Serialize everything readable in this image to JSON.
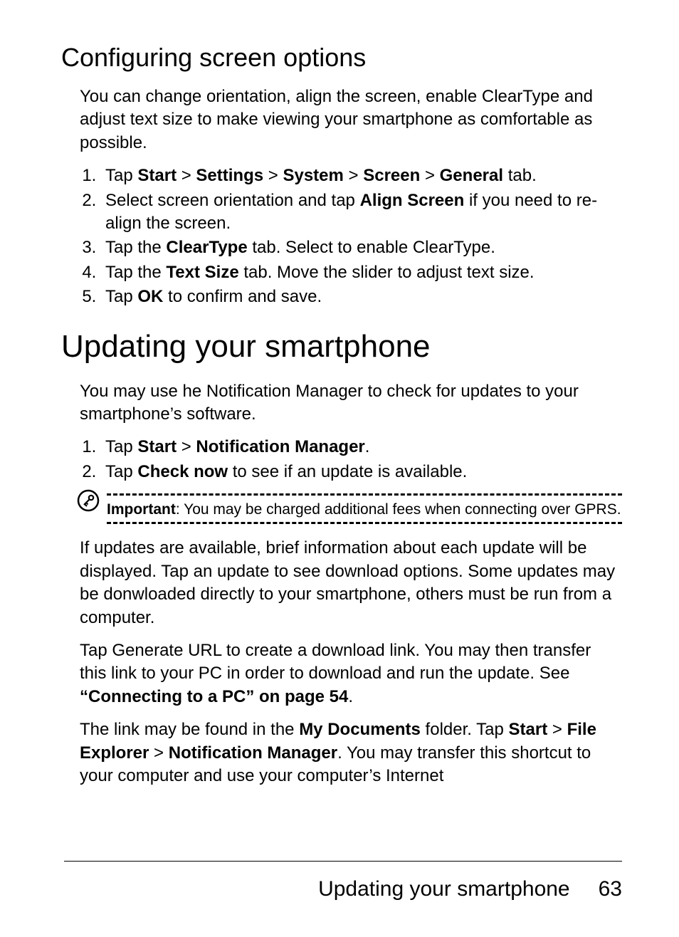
{
  "section1": {
    "heading": "Configuring screen options",
    "intro": "You can change orientation, align the screen, enable ClearType and adjust text size to make viewing your smart­phone as comfortable as possible.",
    "steps": {
      "s1_a": "Tap ",
      "s1_b": "Start",
      "s1_c": " > ",
      "s1_d": "Settings",
      "s1_e": " > ",
      "s1_f": "System",
      "s1_g": " > ",
      "s1_h": "Screen",
      "s1_i": " > ",
      "s1_j": "General",
      "s1_k": " tab.",
      "s2_a": "Select screen orientation and tap ",
      "s2_b": "Align Screen",
      "s2_c": " if you need to re-align the screen.",
      "s3_a": "Tap the ",
      "s3_b": "ClearType",
      "s3_c": " tab. Select to enable ClearType.",
      "s4_a": "Tap the ",
      "s4_b": "Text Size",
      "s4_c": " tab. Move the slider to adjust text size.",
      "s5_a": "Tap ",
      "s5_b": "OK",
      "s5_c": " to confirm and save."
    }
  },
  "section2": {
    "heading": "Updating your smartphone",
    "intro": "You may use he Notification Manager to check for updates to your smartphone’s software.",
    "steps": {
      "s1_a": "Tap ",
      "s1_b": "Start",
      "s1_c": " > ",
      "s1_d": "Notification Manager",
      "s1_e": ".",
      "s2_a": "Tap ",
      "s2_b": "Check now",
      "s2_c": " to see if an update is available."
    },
    "note": {
      "label": "Important",
      "text": ": You may be charged additional fees when connecting over GPRS."
    },
    "para1": "If updates are available, brief information about each update will be displayed. Tap an update to see download options. Some updates may be donwloaded directly to your smart­phone, others must be run from a computer.",
    "para2_a": "Tap Generate URL to create a download link. You may then transfer this link to your PC in order to download and run the update. See ",
    "para2_b": "“Connecting to a PC” on page 54",
    "para2_c": ".",
    "para3_a": "The link may be found in the ",
    "para3_b": "My Documents",
    "para3_c": " folder. Tap ",
    "para3_d": "Start",
    "para3_e": " > ",
    "para3_f": "File Explorer",
    "para3_g": " > ",
    "para3_h": "Notification Manager",
    "para3_i": ". You may transfer this shortcut to your computer and use your computer’s Internet"
  },
  "footer": {
    "title": "Updating your smartphone",
    "page": "63"
  }
}
